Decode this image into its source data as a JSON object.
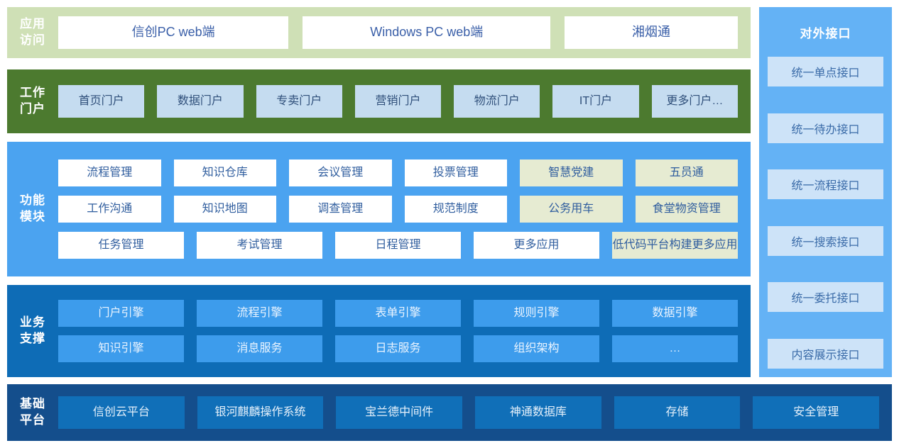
{
  "colors": {
    "app_access_bg": "#cfe0b6",
    "work_portal_bg": "#4c7a2f",
    "func_modules_bg": "#4ba3f0",
    "biz_support_bg": "#0e6cb6",
    "base_platform_bg": "#144e8c",
    "ext_panel_bg": "#64b2f5",
    "card_white": "#ffffff",
    "card_khaki": "#e6ebd2",
    "card_light_blue": "#c5dcf0",
    "text_blue": "#3a5fa8"
  },
  "app_access": {
    "label": "应用\n访问",
    "items": [
      {
        "label": "信创PC web端"
      },
      {
        "label": "Windows PC web端"
      },
      {
        "label": "湘烟通"
      }
    ]
  },
  "work_portal": {
    "label": "工作\n门户",
    "items": [
      {
        "label": "首页门户"
      },
      {
        "label": "数据门户"
      },
      {
        "label": "专卖门户"
      },
      {
        "label": "营销门户"
      },
      {
        "label": "物流门户"
      },
      {
        "label": "IT门户"
      },
      {
        "label": "更多门户…"
      }
    ]
  },
  "func_modules": {
    "label": "功能\n模块",
    "rows": [
      [
        {
          "label": "流程管理",
          "style": "white"
        },
        {
          "label": "知识仓库",
          "style": "white"
        },
        {
          "label": "会议管理",
          "style": "white"
        },
        {
          "label": "投票管理",
          "style": "white"
        },
        {
          "label": "智慧党建",
          "style": "khaki"
        },
        {
          "label": "五员通",
          "style": "khaki"
        }
      ],
      [
        {
          "label": "工作沟通",
          "style": "white"
        },
        {
          "label": "知识地图",
          "style": "white"
        },
        {
          "label": "调查管理",
          "style": "white"
        },
        {
          "label": "规范制度",
          "style": "white"
        },
        {
          "label": "公务用车",
          "style": "khaki"
        },
        {
          "label": "食堂物资管理",
          "style": "khaki"
        }
      ],
      [
        {
          "label": "任务管理",
          "style": "white"
        },
        {
          "label": "考试管理",
          "style": "white"
        },
        {
          "label": "日程管理",
          "style": "white"
        },
        {
          "label": "更多应用",
          "style": "white"
        },
        {
          "label": "低代码平台构建更多应用",
          "style": "khaki wide2"
        }
      ]
    ]
  },
  "biz_support": {
    "label": "业务\n支撑",
    "rows": [
      [
        {
          "label": "门户引擎"
        },
        {
          "label": "流程引擎"
        },
        {
          "label": "表单引擎"
        },
        {
          "label": "规则引擎"
        },
        {
          "label": "数据引擎"
        }
      ],
      [
        {
          "label": "知识引擎"
        },
        {
          "label": "消息服务"
        },
        {
          "label": "日志服务"
        },
        {
          "label": "组织架构"
        },
        {
          "label": "…"
        }
      ]
    ]
  },
  "base_platform": {
    "label": "基础\n平台",
    "items": [
      {
        "label": "信创云平台"
      },
      {
        "label": "银河麒麟操作系统"
      },
      {
        "label": "宝兰德中间件"
      },
      {
        "label": "神通数据库"
      },
      {
        "label": "存储"
      },
      {
        "label": "安全管理"
      }
    ]
  },
  "ext_interfaces": {
    "title": "对外接口",
    "items": [
      {
        "label": "统一单点接口"
      },
      {
        "label": "统一待办接口"
      },
      {
        "label": "统一流程接口"
      },
      {
        "label": "统一搜索接口"
      },
      {
        "label": "统一委托接口"
      },
      {
        "label": "内容展示接口"
      }
    ]
  }
}
